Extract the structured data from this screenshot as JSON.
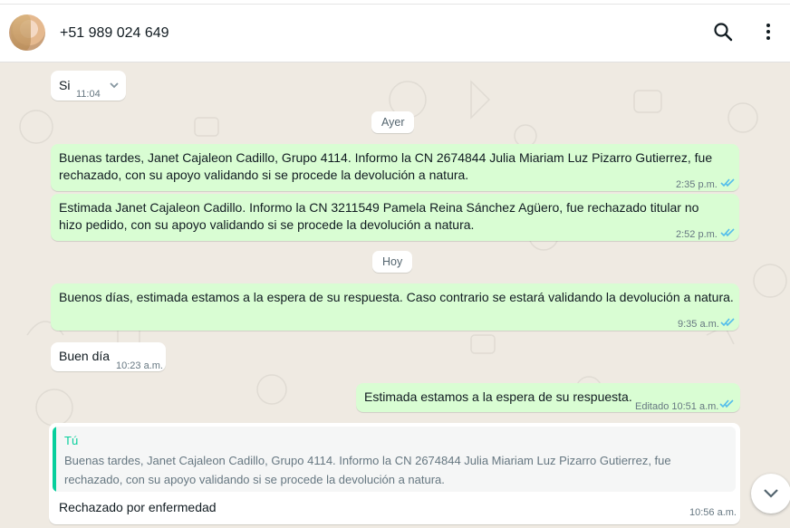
{
  "header": {
    "contact_name": "+51 989 024 649",
    "avatar_icon": "contact-avatar",
    "search_icon": "search-icon",
    "menu_icon": "menu-icon"
  },
  "chat": {
    "day_chips": [
      "Ayer",
      "Hoy"
    ],
    "messages": [
      {
        "dir": "in",
        "text": "Si",
        "time": "11:04"
      },
      {
        "dir": "out",
        "text": "Buenas tardes, Janet Cajaleon Cadillo, Grupo 4114. Informo la CN 2674844 Julia Miariam Luz Pizarro Gutierrez, fue rechazado, con su apoyo validando si se procede la devolución a natura.",
        "time": "2:35 p.m."
      },
      {
        "dir": "out",
        "text": "Estimada Janet Cajaleon Cadillo. Informo la CN 3211549 Pamela Reina Sánchez Agüero, fue rechazado titular no hizo pedido, con su apoyo validando si se procede la devolución a natura.",
        "time": "2:52 p.m."
      },
      {
        "dir": "out",
        "text": "Buenos días, estimada estamos a la espera de su respuesta. Caso contrario se estará validando la devolución a natura.",
        "time": "9:35 a.m."
      },
      {
        "dir": "in",
        "text": "Buen día",
        "time": "10:23 a.m."
      },
      {
        "dir": "out",
        "text": "Estimada estamos a la espera de su respuesta.",
        "time": "Editado 10:51 a.m."
      },
      {
        "dir": "in",
        "text": "Rechazado por enfermedad",
        "time": "10:56 a.m.",
        "quote_author": "Tú",
        "quote_text": "Buenas tardes, Janet Cajaleon Cadillo, Grupo 4114. Informo la CN 2674844 Julia Miariam Luz Pizarro Gutierrez, fue rechazado, con su apoyo validando si se procede la devolución a natura."
      }
    ]
  },
  "colors": {
    "incoming_bubble": "#ffffff",
    "outgoing_bubble": "#d9fdd3",
    "read_ticks": "#53bdeb",
    "quote_accent": "#06cf9c",
    "chat_background": "#efeae2"
  }
}
